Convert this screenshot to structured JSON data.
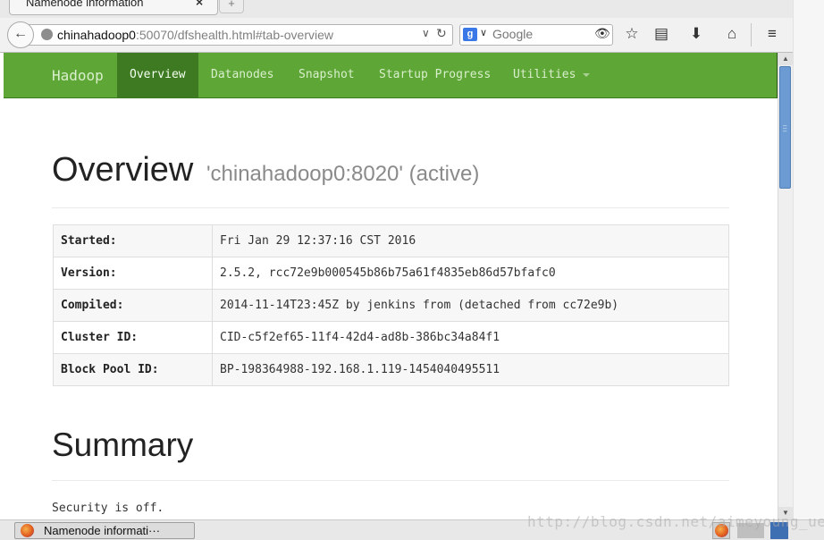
{
  "browser": {
    "tab_title": "Namenode information",
    "tab_close": "×",
    "new_tab": "+",
    "url_host": "chinahadoop0",
    "url_rest": ":50070/dfshealth.html#tab-overview",
    "search_placeholder": "Google",
    "search_engine_letter": "g"
  },
  "hadoop_nav": {
    "brand": "Hadoop",
    "items": [
      {
        "label": "Overview",
        "active": true
      },
      {
        "label": "Datanodes"
      },
      {
        "label": "Snapshot"
      },
      {
        "label": "Startup Progress"
      },
      {
        "label": "Utilities"
      }
    ]
  },
  "overview": {
    "heading": "Overview",
    "subheading": "'chinahadoop0:8020' (active)",
    "rows": [
      {
        "key": "Started:",
        "value": "Fri Jan 29 12:37:16 CST 2016"
      },
      {
        "key": "Version:",
        "value": "2.5.2, rcc72e9b000545b86b75a61f4835eb86d57bfafc0"
      },
      {
        "key": "Compiled:",
        "value": "2014-11-14T23:45Z by jenkins from (detached from cc72e9b)"
      },
      {
        "key": "Cluster ID:",
        "value": "CID-c5f2ef65-11f4-42d4-ad8b-386bc34a84f1"
      },
      {
        "key": "Block Pool ID:",
        "value": "BP-198364988-192.168.1.119-1454040495511"
      }
    ]
  },
  "summary": {
    "heading": "Summary",
    "security_text": "Security is off."
  },
  "taskbar": {
    "task_label": "Namenode informati···"
  },
  "watermark": "http://blog.csdn.net/aimeyoung_ue"
}
